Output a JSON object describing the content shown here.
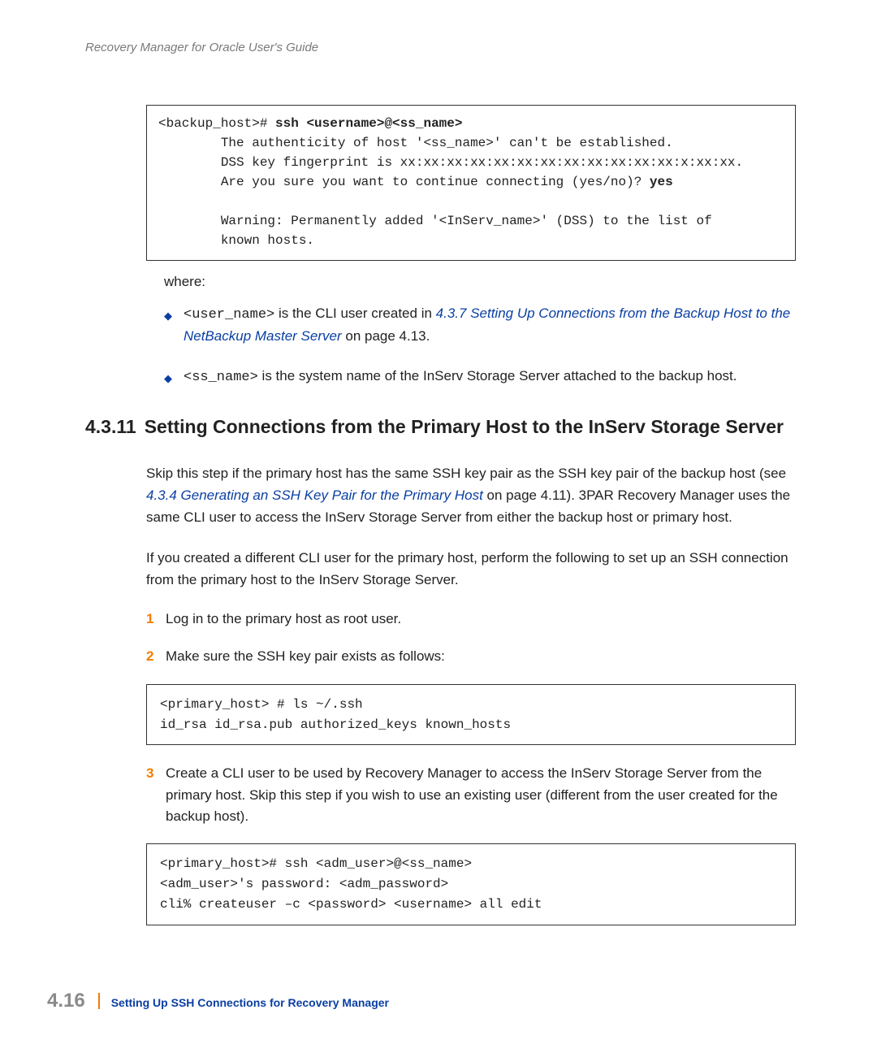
{
  "header": {
    "title": "Recovery Manager for Oracle User's Guide"
  },
  "codebox1": {
    "prompt": "<backup_host># ",
    "command": "ssh <username>@<ss_name>",
    "line1": "        The authenticity of host '<ss_name>' can't be established.",
    "line2": "        DSS key fingerprint is xx:xx:xx:xx:xx:xx:xx:xx:xx:xx:xx:xx:x:xx:xx.",
    "line3": "        Are you sure you want to continue connecting (yes/no)? ",
    "answer": "yes",
    "line4": "        Warning: Permanently added '<InServ_name>' (DSS) to the list of",
    "line5": "        known hosts."
  },
  "where_label": "where:",
  "bullet1": {
    "pre": "<user_name>",
    "mid": " is the CLI user created in ",
    "link": "4.3.7 Setting Up Connections from the Backup Host to the NetBackup Master Server",
    "post": " on page 4.13."
  },
  "bullet2": {
    "pre": "<ss_name>",
    "post": " is the system name of the InServ Storage Server attached to the backup host."
  },
  "section": {
    "num": "4.3.11",
    "title": "Setting Connections from the Primary Host to the InServ Storage Server"
  },
  "para1": {
    "pre": "Skip this step if the primary host has the same SSH key pair as the SSH key pair of the backup host (see ",
    "link": "4.3.4 Generating an SSH Key Pair for the Primary Host",
    "post": " on page 4.11). 3PAR Recovery Manager uses the same CLI user to access the InServ Storage Server from either the backup host or primary host."
  },
  "para2": "If you created a different CLI user for the primary host, perform the following to set up an SSH connection from the primary host to the InServ Storage Server.",
  "steps": {
    "s1": {
      "num": "1",
      "text": "Log in to the primary host as root user."
    },
    "s2": {
      "num": "2",
      "text": "Make sure the SSH key pair exists as follows:"
    },
    "s3": {
      "num": "3",
      "text": "Create a CLI user to be used by Recovery Manager to access the InServ Storage Server from the primary host. Skip this step if you wish to use an existing user (different from the user created for the backup host)."
    }
  },
  "codebox2": "<primary_host> # ls ~/.ssh\nid_rsa id_rsa.pub authorized_keys known_hosts",
  "codebox3": "<primary_host># ssh <adm_user>@<ss_name>\n<adm_user>'s password: <adm_password>\ncli% createuser –c <password> <username> all edit",
  "footer": {
    "page": "4.16",
    "title": "Setting Up SSH Connections for Recovery Manager"
  }
}
